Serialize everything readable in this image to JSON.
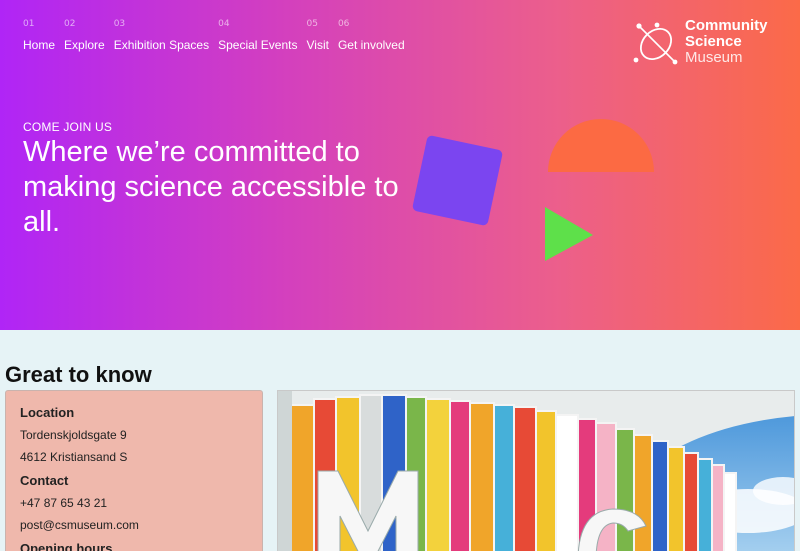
{
  "nav": {
    "items": [
      {
        "num": "01",
        "label": "Home"
      },
      {
        "num": "02",
        "label": "Explore"
      },
      {
        "num": "03",
        "label": "Exhibition Spaces"
      },
      {
        "num": "04",
        "label": "Special Events"
      },
      {
        "num": "05",
        "label": "Visit"
      },
      {
        "num": "06",
        "label": "Get involved"
      }
    ]
  },
  "logo": {
    "line1": "Community",
    "line2": "Science",
    "line3": "Museum",
    "icon": "atom-orbit-icon"
  },
  "hero": {
    "eyebrow": "COME JOIN US",
    "headline": "Where we’re committed to making science accessible to all.",
    "colors": {
      "gradient_start": "#b025f6",
      "gradient_end": "#fb6a48",
      "square": "#7b45f0",
      "semicircle": "#fc6a43",
      "triangle": "#5ee04a"
    }
  },
  "info": {
    "section_title": "Great to know",
    "location_heading": "Location",
    "address_line1": "Tordenskjoldsgate 9",
    "address_line2": "4612 Kristiansand S",
    "contact_heading": "Contact",
    "phone": "+47 87 65 43 21",
    "email": "post@csmuseum.com",
    "hours_heading": "Opening hours"
  },
  "photo": {
    "icon": "museum-building-photo"
  }
}
